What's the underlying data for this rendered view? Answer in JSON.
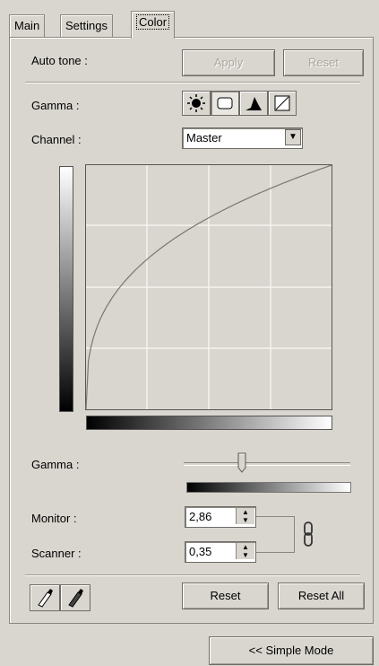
{
  "tabs": [
    {
      "label": "Main"
    },
    {
      "label": "Settings"
    },
    {
      "label": "Color"
    }
  ],
  "auto_tone": {
    "label": "Auto tone :",
    "apply_label": "Apply",
    "reset_label": "Reset"
  },
  "gamma_modes": {
    "label": "Gamma :",
    "icons": [
      "brightness-icon",
      "gamma-curve-icon",
      "histogram-icon",
      "linear-curve-icon"
    ],
    "selected": "gamma-curve-icon"
  },
  "channel": {
    "label": "Channel :",
    "value": "Master"
  },
  "gamma_slider": {
    "label": "Gamma :",
    "level": 0.35
  },
  "monitor": {
    "label": "Monitor :",
    "value": "2,86"
  },
  "scanner": {
    "label": "Scanner :",
    "value": "0,35"
  },
  "bottom_buttons": {
    "reset_label": "Reset",
    "reset_all_label": "Reset All"
  },
  "footer": {
    "simple_mode_label": "<< Simple Mode"
  },
  "curve": {
    "gamma": 0.35
  }
}
